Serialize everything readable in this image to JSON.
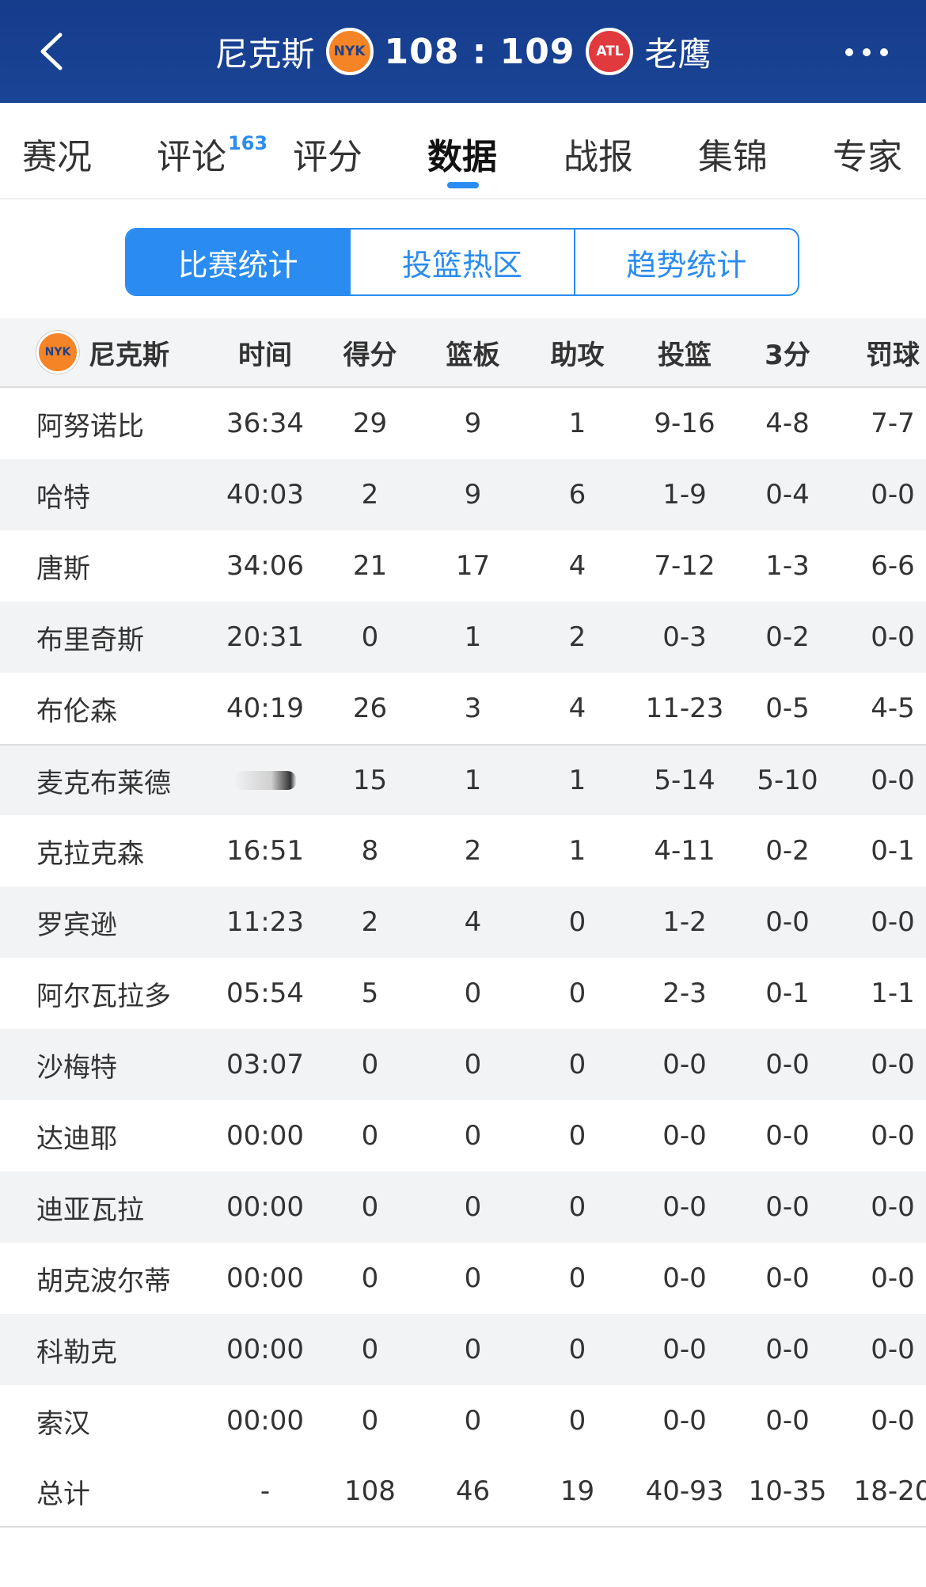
{
  "header": {
    "home_team": "尼克斯",
    "home_logo_text": "NYK",
    "score": "108 : 109",
    "away_logo_text": "ATL",
    "away_team": "老鹰"
  },
  "tabs": [
    {
      "label": "赛况"
    },
    {
      "label": "评论",
      "badge": "163"
    },
    {
      "label": "评分"
    },
    {
      "label": "数据"
    },
    {
      "label": "战报"
    },
    {
      "label": "集锦"
    },
    {
      "label": "专家"
    }
  ],
  "segments": [
    "比赛统计",
    "投篮热区",
    "趋势统计"
  ],
  "table": {
    "team_label": "尼克斯",
    "team_logo_text": "NYK",
    "columns": [
      "时间",
      "得分",
      "篮板",
      "助攻",
      "投篮",
      "3分",
      "罚球"
    ],
    "rows": [
      {
        "name": "阿努诺比",
        "time": "36:34",
        "pts": "29",
        "reb": "9",
        "ast": "1",
        "fg": "9-16",
        "tp": "4-8",
        "ft": "7-7"
      },
      {
        "name": "哈特",
        "time": "40:03",
        "pts": "2",
        "reb": "9",
        "ast": "6",
        "fg": "1-9",
        "tp": "0-4",
        "ft": "0-0"
      },
      {
        "name": "唐斯",
        "time": "34:06",
        "pts": "21",
        "reb": "17",
        "ast": "4",
        "fg": "7-12",
        "tp": "1-3",
        "ft": "6-6"
      },
      {
        "name": "布里奇斯",
        "time": "20:31",
        "pts": "0",
        "reb": "1",
        "ast": "2",
        "fg": "0-3",
        "tp": "0-2",
        "ft": "0-0"
      },
      {
        "name": "布伦森",
        "time": "40:19",
        "pts": "26",
        "reb": "3",
        "ast": "4",
        "fg": "11-23",
        "tp": "0-5",
        "ft": "4-5"
      },
      {
        "name": "麦克布莱德",
        "time": "",
        "pts": "15",
        "reb": "1",
        "ast": "1",
        "fg": "5-14",
        "tp": "5-10",
        "ft": "0-0"
      },
      {
        "name": "克拉克森",
        "time": "16:51",
        "pts": "8",
        "reb": "2",
        "ast": "1",
        "fg": "4-11",
        "tp": "0-2",
        "ft": "0-1"
      },
      {
        "name": "罗宾逊",
        "time": "11:23",
        "pts": "2",
        "reb": "4",
        "ast": "0",
        "fg": "1-2",
        "tp": "0-0",
        "ft": "0-0"
      },
      {
        "name": "阿尔瓦拉多",
        "time": "05:54",
        "pts": "5",
        "reb": "0",
        "ast": "0",
        "fg": "2-3",
        "tp": "0-1",
        "ft": "1-1"
      },
      {
        "name": "沙梅特",
        "time": "03:07",
        "pts": "0",
        "reb": "0",
        "ast": "0",
        "fg": "0-0",
        "tp": "0-0",
        "ft": "0-0"
      },
      {
        "name": "达迪耶",
        "time": "00:00",
        "pts": "0",
        "reb": "0",
        "ast": "0",
        "fg": "0-0",
        "tp": "0-0",
        "ft": "0-0"
      },
      {
        "name": "迪亚瓦拉",
        "time": "00:00",
        "pts": "0",
        "reb": "0",
        "ast": "0",
        "fg": "0-0",
        "tp": "0-0",
        "ft": "0-0"
      },
      {
        "name": "胡克波尔蒂",
        "time": "00:00",
        "pts": "0",
        "reb": "0",
        "ast": "0",
        "fg": "0-0",
        "tp": "0-0",
        "ft": "0-0"
      },
      {
        "name": "科勒克",
        "time": "00:00",
        "pts": "0",
        "reb": "0",
        "ast": "0",
        "fg": "0-0",
        "tp": "0-0",
        "ft": "0-0"
      },
      {
        "name": "索汉",
        "time": "00:00",
        "pts": "0",
        "reb": "0",
        "ast": "0",
        "fg": "0-0",
        "tp": "0-0",
        "ft": "0-0"
      }
    ],
    "total": {
      "name": "总计",
      "time": "-",
      "pts": "108",
      "reb": "46",
      "ast": "19",
      "fg": "40-93",
      "tp": "10-35",
      "ft": "18-20"
    }
  }
}
